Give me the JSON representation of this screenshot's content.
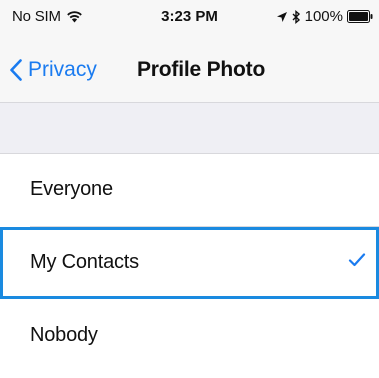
{
  "status_bar": {
    "carrier": "No SIM",
    "time": "3:23 PM",
    "battery": "100%",
    "icons": [
      "wifi-icon",
      "location-icon",
      "bluetooth-icon",
      "battery-icon"
    ]
  },
  "nav": {
    "back_label": "Privacy",
    "title": "Profile Photo"
  },
  "options": [
    {
      "label": "Everyone",
      "selected": false
    },
    {
      "label": "My Contacts",
      "selected": true
    },
    {
      "label": "Nobody",
      "selected": false
    }
  ],
  "colors": {
    "accent": "#1a7bf0",
    "selection_border": "#1a8ae0",
    "section_background": "#efeff4"
  }
}
